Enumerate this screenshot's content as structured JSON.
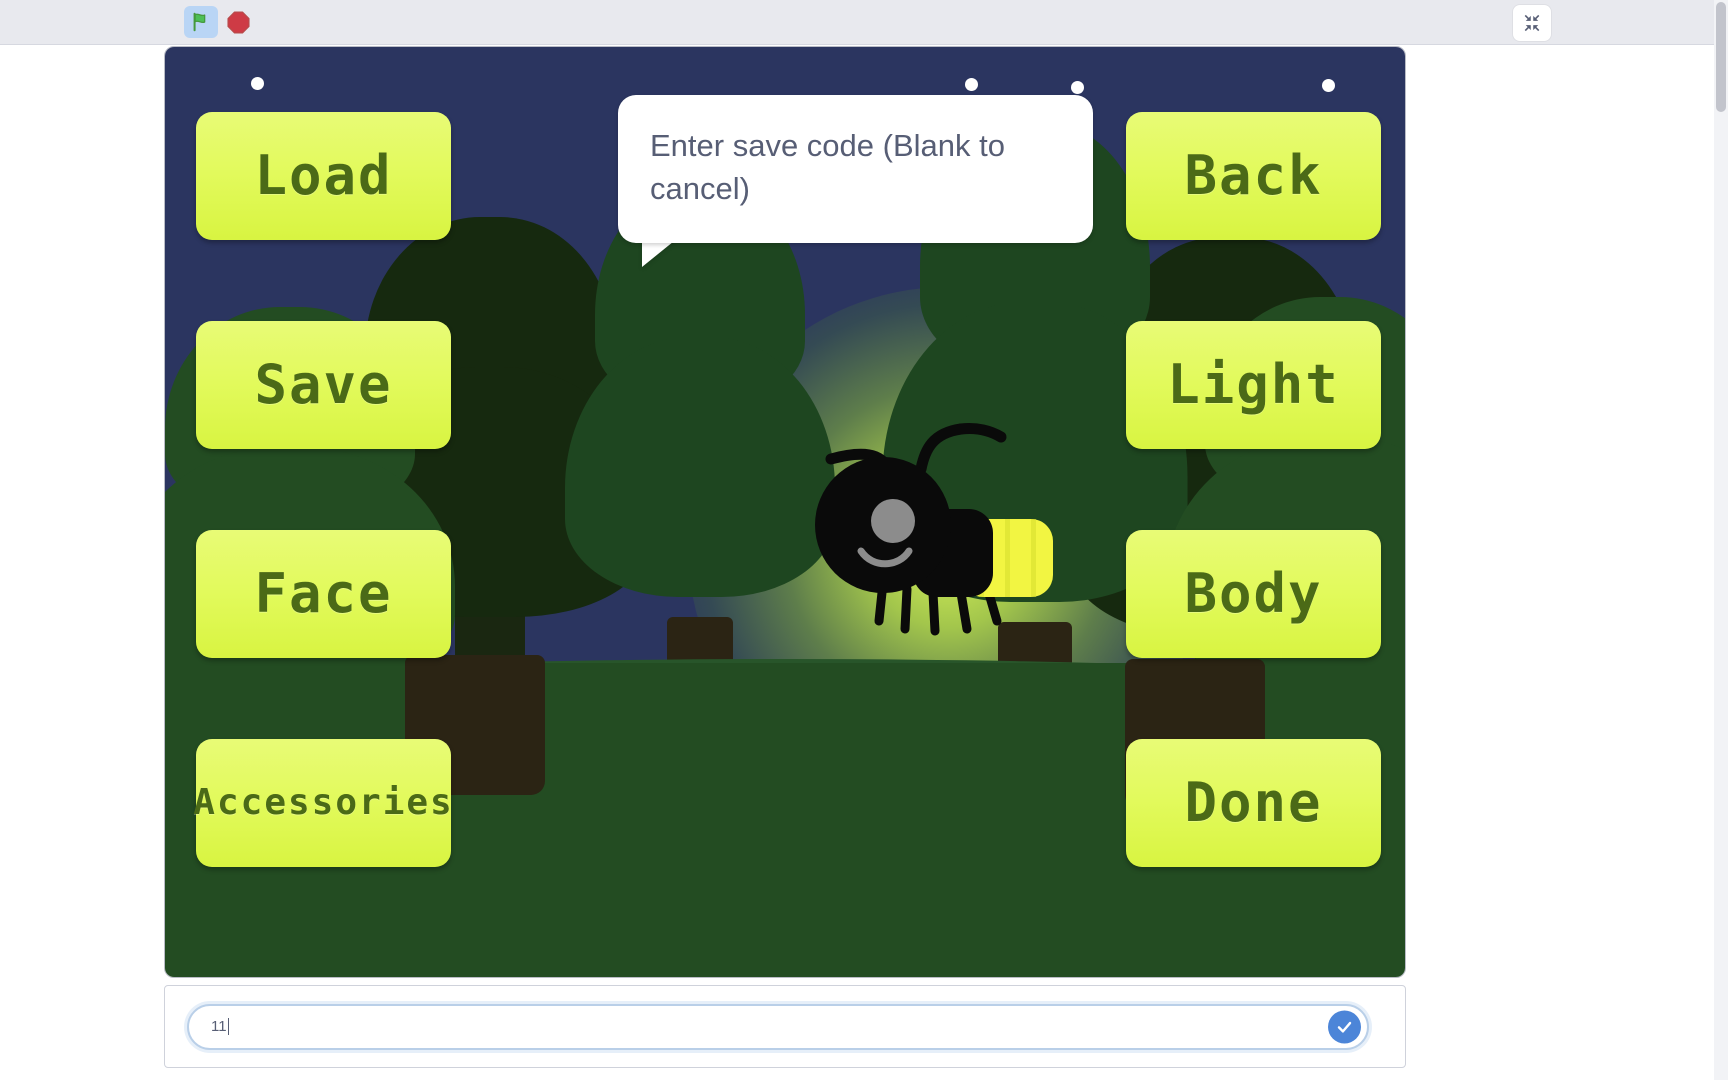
{
  "toolbar": {
    "green_flag_icon": "green-flag-icon",
    "stop_icon": "stop-sign-icon",
    "fullscreen_icon": "exit-fullscreen-icon"
  },
  "stage": {
    "speech_bubble": {
      "text": "Enter save code (Blank to cancel)"
    },
    "sprite": {
      "name": "firefly",
      "body_color": "#0a0a0a",
      "eye_color": "#8c8c8c",
      "light_color": "#f2f542"
    },
    "background": {
      "sky_color": "#2b3560",
      "ground_color": "#234c22",
      "tree_color": "#20401f",
      "trunk_color": "#2b2414",
      "star_color": "#ffffff",
      "glow_color": "#e2ff5a"
    },
    "buttons_left": [
      {
        "label": "Load",
        "size": "big"
      },
      {
        "label": "Save",
        "size": "big"
      },
      {
        "label": "Face",
        "size": "big"
      },
      {
        "label": "Accessories",
        "size": "small"
      }
    ],
    "buttons_right": [
      {
        "label": "Back",
        "size": "big"
      },
      {
        "label": "Light",
        "size": "big"
      },
      {
        "label": "Body",
        "size": "big"
      },
      {
        "label": "Done",
        "size": "big"
      }
    ],
    "button_color": "#e2fa5c",
    "button_text_color": "#4b6a17"
  },
  "ask": {
    "value": "11",
    "placeholder": "",
    "submit_icon": "check-icon"
  }
}
